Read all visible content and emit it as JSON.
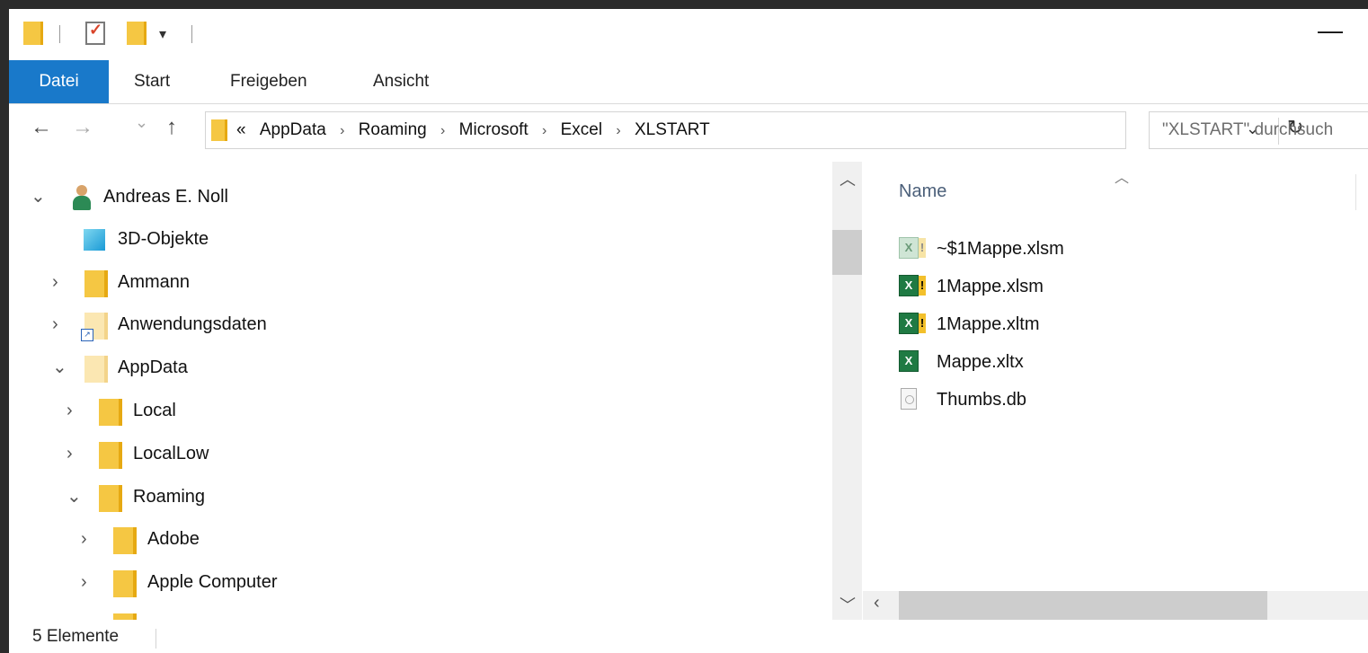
{
  "titlebar": {
    "quick_access": [
      "folder-icon",
      "properties-icon",
      "new-folder-icon",
      "customize-dropdown-icon"
    ],
    "minimize_label": "—"
  },
  "ribbon": {
    "tabs": [
      {
        "label": "Datei",
        "active": true
      },
      {
        "label": "Start"
      },
      {
        "label": "Freigeben"
      },
      {
        "label": "Ansicht"
      }
    ],
    "accent_color": "#1979ca"
  },
  "nav": {
    "back_icon": "←",
    "forward_icon": "→",
    "recent_icon": "⌄",
    "up_icon": "↑"
  },
  "address": {
    "overflow": "«",
    "crumbs": [
      "AppData",
      "Roaming",
      "Microsoft",
      "Excel",
      "XLSTART"
    ],
    "separator": "›"
  },
  "search": {
    "placeholder": "\"XLSTART\" durchsuch"
  },
  "tree": [
    {
      "label": "Andreas E. Noll",
      "icon": "user-icon",
      "chevron": "expanded"
    },
    {
      "label": "3D-Objekte",
      "icon": "cube-icon",
      "chevron": "none"
    },
    {
      "label": "Ammann",
      "icon": "folder-icon",
      "chevron": "collapsed"
    },
    {
      "label": "Anwendungsdaten",
      "icon": "folder-shortcut-icon",
      "chevron": "collapsed"
    },
    {
      "label": "AppData",
      "icon": "folder-icon",
      "chevron": "expanded"
    },
    {
      "label": "Local",
      "icon": "folder-icon",
      "chevron": "collapsed"
    },
    {
      "label": "LocalLow",
      "icon": "folder-icon",
      "chevron": "collapsed"
    },
    {
      "label": "Roaming",
      "icon": "folder-icon",
      "chevron": "expanded"
    },
    {
      "label": "Adobe",
      "icon": "folder-icon",
      "chevron": "collapsed"
    },
    {
      "label": "Apple Computer",
      "icon": "folder-icon",
      "chevron": "collapsed"
    }
  ],
  "files": {
    "column_name": "Name",
    "items": [
      {
        "name": "~$1Mappe.xlsm",
        "icon": "excel-macro-icon",
        "hidden": true
      },
      {
        "name": "1Mappe.xlsm",
        "icon": "excel-macro-icon"
      },
      {
        "name": "1Mappe.xltm",
        "icon": "excel-template-macro-icon"
      },
      {
        "name": "Mappe.xltx",
        "icon": "excel-template-icon"
      },
      {
        "name": "Thumbs.db",
        "icon": "db-file-icon"
      }
    ]
  },
  "status": {
    "count_text": "5 Elemente"
  }
}
